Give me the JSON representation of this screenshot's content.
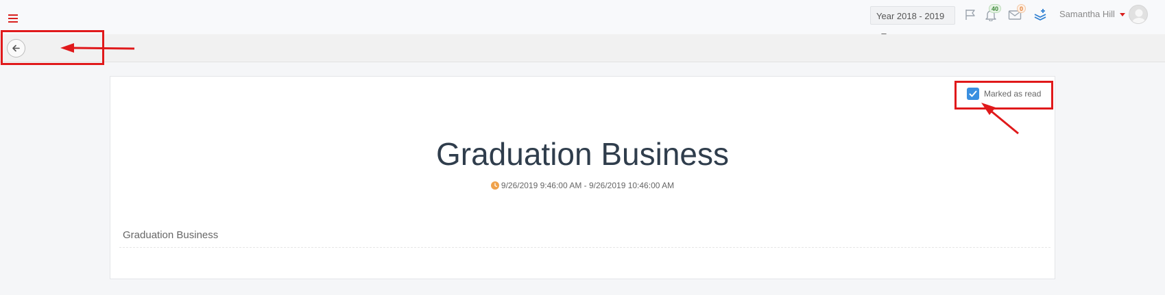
{
  "header": {
    "menu_icon": "hamburger-icon",
    "year_selector": "Year 2018 - 2019",
    "flag_icon": "flag-icon",
    "notifications": {
      "icon": "bell-icon",
      "count": "40"
    },
    "messages": {
      "icon": "envelope-icon",
      "count": "0"
    },
    "layers_icon": "layers-icon",
    "user_name": "Samantha Hill",
    "avatar": "default-avatar"
  },
  "toolbar": {
    "back_icon": "arrow-left-icon"
  },
  "event": {
    "marked_read_label": "Marked as read",
    "marked_read": true,
    "title": "Graduation Business",
    "datetime": "9/26/2019 9:46:00 AM - 9/26/2019 10:46:00 AM",
    "description": "Graduation Business"
  },
  "colors": {
    "accent_red": "#d9201e",
    "checkbox_blue": "#3a8fe0",
    "clock_orange": "#f0a24b",
    "title_color": "#2f3d4c",
    "annotation_red": "#e0191b"
  }
}
